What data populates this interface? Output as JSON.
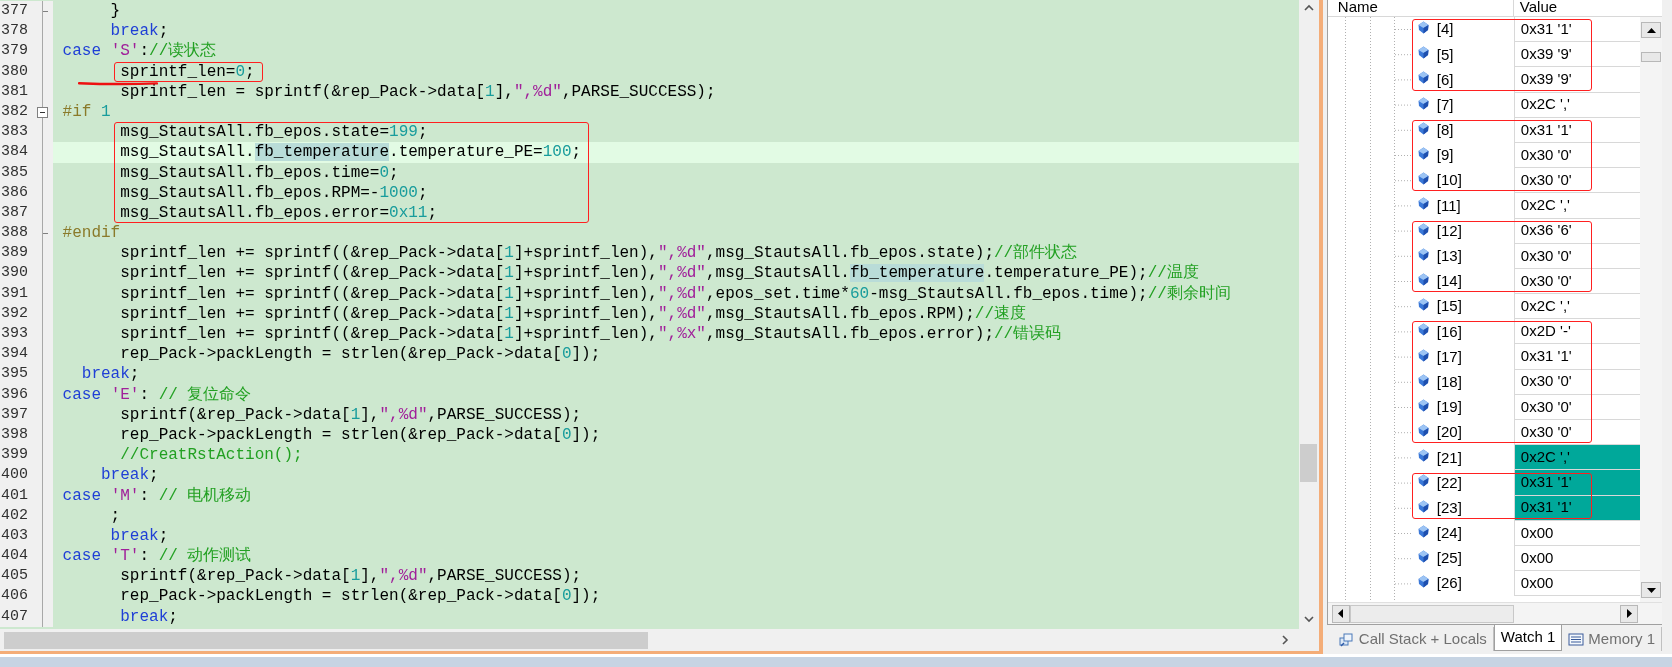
{
  "editor": {
    "lines": [
      {
        "number": "377",
        "fold_start": false,
        "fold_end": true,
        "current": false,
        "boxed": false,
        "underlined": false,
        "spans": [
          {
            "kind": "plain",
            "text": "      }"
          }
        ]
      },
      {
        "number": "378",
        "fold_start": false,
        "fold_end": false,
        "current": false,
        "boxed": false,
        "underlined": false,
        "spans": [
          {
            "kind": "keyword",
            "text": "      break"
          },
          {
            "kind": "plain",
            "text": ";"
          }
        ]
      },
      {
        "number": "379",
        "fold_start": false,
        "fold_end": false,
        "current": false,
        "boxed": false,
        "underlined": false,
        "spans": [
          {
            "kind": "keyword",
            "text": " case"
          },
          {
            "kind": "string",
            "text": " 'S'"
          },
          {
            "kind": "plain",
            "text": ":"
          },
          {
            "kind": "comment",
            "text": "//读状态"
          }
        ]
      },
      {
        "number": "380",
        "fold_start": false,
        "fold_end": false,
        "current": false,
        "boxed": true,
        "underlined": true,
        "spans": [
          {
            "kind": "plain",
            "text": "       sprintf_len="
          },
          {
            "kind": "number",
            "text": "0"
          },
          {
            "kind": "plain",
            "text": ";"
          }
        ]
      },
      {
        "number": "381",
        "fold_start": false,
        "fold_end": false,
        "current": false,
        "boxed": false,
        "underlined": false,
        "spans": [
          {
            "kind": "plain",
            "text": "       sprintf_len = sprintf(&rep_Pack->data["
          },
          {
            "kind": "number",
            "text": "1"
          },
          {
            "kind": "plain",
            "text": "],"
          },
          {
            "kind": "string",
            "text": "\",%d\""
          },
          {
            "kind": "plain",
            "text": ",PARSE_SUCCESS);"
          }
        ]
      },
      {
        "number": "382",
        "fold_start": true,
        "fold_end": false,
        "current": false,
        "boxed": false,
        "underlined": false,
        "spans": [
          {
            "kind": "preprocessor",
            "text": " #if"
          },
          {
            "kind": "number",
            "text": " 1"
          }
        ]
      },
      {
        "number": "383",
        "fold_start": false,
        "fold_end": false,
        "current": false,
        "boxed": true,
        "underlined": false,
        "spans": [
          {
            "kind": "plain",
            "text": "       msg_StautsAll.fb_epos.state="
          },
          {
            "kind": "number",
            "text": "199"
          },
          {
            "kind": "plain",
            "text": ";"
          }
        ]
      },
      {
        "number": "384",
        "fold_start": false,
        "fold_end": false,
        "current": true,
        "boxed": true,
        "underlined": false,
        "spans": [
          {
            "kind": "plain",
            "text": "       msg_StautsAll."
          },
          {
            "kind": "match",
            "text": "fb_temperature"
          },
          {
            "kind": "plain",
            "text": ".temperature_PE="
          },
          {
            "kind": "number",
            "text": "100"
          },
          {
            "kind": "plain",
            "text": ";"
          }
        ]
      },
      {
        "number": "385",
        "fold_start": false,
        "fold_end": false,
        "current": false,
        "boxed": true,
        "underlined": false,
        "spans": [
          {
            "kind": "plain",
            "text": "       msg_StautsAll.fb_epos.time="
          },
          {
            "kind": "number",
            "text": "0"
          },
          {
            "kind": "plain",
            "text": ";"
          }
        ]
      },
      {
        "number": "386",
        "fold_start": false,
        "fold_end": false,
        "current": false,
        "boxed": true,
        "underlined": false,
        "spans": [
          {
            "kind": "plain",
            "text": "       msg_StautsAll.fb_epos.RPM=-"
          },
          {
            "kind": "number",
            "text": "1000"
          },
          {
            "kind": "plain",
            "text": ";"
          }
        ]
      },
      {
        "number": "387",
        "fold_start": false,
        "fold_end": false,
        "current": false,
        "boxed": true,
        "underlined": false,
        "spans": [
          {
            "kind": "plain",
            "text": "       msg_StautsAll.fb_epos.error="
          },
          {
            "kind": "number",
            "text": "0x11"
          },
          {
            "kind": "plain",
            "text": ";"
          }
        ]
      },
      {
        "number": "388",
        "fold_start": false,
        "fold_end": true,
        "current": false,
        "boxed": false,
        "underlined": false,
        "spans": [
          {
            "kind": "preprocessor",
            "text": " #endif"
          }
        ]
      },
      {
        "number": "389",
        "fold_start": false,
        "fold_end": false,
        "current": false,
        "boxed": false,
        "underlined": false,
        "spans": [
          {
            "kind": "plain",
            "text": "       sprintf_len += sprintf((&rep_Pack->data["
          },
          {
            "kind": "number",
            "text": "1"
          },
          {
            "kind": "plain",
            "text": "]+sprintf_len),"
          },
          {
            "kind": "string",
            "text": "\",%d\""
          },
          {
            "kind": "plain",
            "text": ",msg_StautsAll.fb_epos.state);"
          },
          {
            "kind": "comment",
            "text": "//部件状态"
          }
        ]
      },
      {
        "number": "390",
        "fold_start": false,
        "fold_end": false,
        "current": false,
        "boxed": false,
        "underlined": false,
        "spans": [
          {
            "kind": "plain",
            "text": "       sprintf_len += sprintf((&rep_Pack->data["
          },
          {
            "kind": "number",
            "text": "1"
          },
          {
            "kind": "plain",
            "text": "]+sprintf_len),"
          },
          {
            "kind": "string",
            "text": "\",%d\""
          },
          {
            "kind": "plain",
            "text": ",msg_StautsAll."
          },
          {
            "kind": "match",
            "text": "fb_temperature"
          },
          {
            "kind": "plain",
            "text": ".temperature_PE);"
          },
          {
            "kind": "comment",
            "text": "//温度"
          }
        ]
      },
      {
        "number": "391",
        "fold_start": false,
        "fold_end": false,
        "current": false,
        "boxed": false,
        "underlined": false,
        "spans": [
          {
            "kind": "plain",
            "text": "       sprintf_len += sprintf((&rep_Pack->data["
          },
          {
            "kind": "number",
            "text": "1"
          },
          {
            "kind": "plain",
            "text": "]+sprintf_len),"
          },
          {
            "kind": "string",
            "text": "\",%d\""
          },
          {
            "kind": "plain",
            "text": ",epos_set.time*"
          },
          {
            "kind": "number",
            "text": "60"
          },
          {
            "kind": "plain",
            "text": "-msg_StautsAll.fb_epos.time);"
          },
          {
            "kind": "comment",
            "text": "//剩余时间"
          }
        ]
      },
      {
        "number": "392",
        "fold_start": false,
        "fold_end": false,
        "current": false,
        "boxed": false,
        "underlined": false,
        "spans": [
          {
            "kind": "plain",
            "text": "       sprintf_len += sprintf((&rep_Pack->data["
          },
          {
            "kind": "number",
            "text": "1"
          },
          {
            "kind": "plain",
            "text": "]+sprintf_len),"
          },
          {
            "kind": "string",
            "text": "\",%d\""
          },
          {
            "kind": "plain",
            "text": ",msg_StautsAll.fb_epos.RPM);"
          },
          {
            "kind": "comment",
            "text": "//速度"
          }
        ]
      },
      {
        "number": "393",
        "fold_start": false,
        "fold_end": false,
        "current": false,
        "boxed": false,
        "underlined": false,
        "spans": [
          {
            "kind": "plain",
            "text": "       sprintf_len += sprintf((&rep_Pack->data["
          },
          {
            "kind": "number",
            "text": "1"
          },
          {
            "kind": "plain",
            "text": "]+sprintf_len),"
          },
          {
            "kind": "string",
            "text": "\",%x\""
          },
          {
            "kind": "plain",
            "text": ",msg_StautsAll.fb_epos.error);"
          },
          {
            "kind": "comment",
            "text": "//错误码"
          }
        ]
      },
      {
        "number": "394",
        "fold_start": false,
        "fold_end": false,
        "current": false,
        "boxed": false,
        "underlined": false,
        "spans": [
          {
            "kind": "plain",
            "text": "       rep_Pack->packLength = strlen(&rep_Pack->data["
          },
          {
            "kind": "number",
            "text": "0"
          },
          {
            "kind": "plain",
            "text": "]);"
          }
        ]
      },
      {
        "number": "395",
        "fold_start": false,
        "fold_end": false,
        "current": false,
        "boxed": false,
        "underlined": false,
        "spans": [
          {
            "kind": "keyword",
            "text": "   break"
          },
          {
            "kind": "plain",
            "text": ";"
          }
        ]
      },
      {
        "number": "396",
        "fold_start": false,
        "fold_end": false,
        "current": false,
        "boxed": false,
        "underlined": false,
        "spans": [
          {
            "kind": "keyword",
            "text": " case"
          },
          {
            "kind": "string",
            "text": " 'E'"
          },
          {
            "kind": "plain",
            "text": ":"
          },
          {
            "kind": "comment",
            "text": " // 复位命令"
          }
        ]
      },
      {
        "number": "397",
        "fold_start": false,
        "fold_end": false,
        "current": false,
        "boxed": false,
        "underlined": false,
        "spans": [
          {
            "kind": "plain",
            "text": "       sprintf(&rep_Pack->data["
          },
          {
            "kind": "number",
            "text": "1"
          },
          {
            "kind": "plain",
            "text": "],"
          },
          {
            "kind": "string",
            "text": "\",%d\""
          },
          {
            "kind": "plain",
            "text": ",PARSE_SUCCESS);"
          }
        ]
      },
      {
        "number": "398",
        "fold_start": false,
        "fold_end": false,
        "current": false,
        "boxed": false,
        "underlined": false,
        "spans": [
          {
            "kind": "plain",
            "text": "       rep_Pack->packLength = strlen(&rep_Pack->data["
          },
          {
            "kind": "number",
            "text": "0"
          },
          {
            "kind": "plain",
            "text": "]);"
          }
        ]
      },
      {
        "number": "399",
        "fold_start": false,
        "fold_end": false,
        "current": false,
        "boxed": false,
        "underlined": false,
        "spans": [
          {
            "kind": "comment",
            "text": "       //CreatRstAction();"
          }
        ]
      },
      {
        "number": "400",
        "fold_start": false,
        "fold_end": false,
        "current": false,
        "boxed": false,
        "underlined": false,
        "spans": [
          {
            "kind": "keyword",
            "text": "     break"
          },
          {
            "kind": "plain",
            "text": ";"
          }
        ]
      },
      {
        "number": "401",
        "fold_start": false,
        "fold_end": false,
        "current": false,
        "boxed": false,
        "underlined": false,
        "spans": [
          {
            "kind": "keyword",
            "text": " case"
          },
          {
            "kind": "string",
            "text": " 'M'"
          },
          {
            "kind": "plain",
            "text": ":"
          },
          {
            "kind": "comment",
            "text": " // 电机移动"
          }
        ]
      },
      {
        "number": "402",
        "fold_start": false,
        "fold_end": false,
        "current": false,
        "boxed": false,
        "underlined": false,
        "spans": [
          {
            "kind": "plain",
            "text": "      ;"
          }
        ]
      },
      {
        "number": "403",
        "fold_start": false,
        "fold_end": false,
        "current": false,
        "boxed": false,
        "underlined": false,
        "spans": [
          {
            "kind": "keyword",
            "text": "      break"
          },
          {
            "kind": "plain",
            "text": ";"
          }
        ]
      },
      {
        "number": "404",
        "fold_start": false,
        "fold_end": false,
        "current": false,
        "boxed": false,
        "underlined": false,
        "spans": [
          {
            "kind": "keyword",
            "text": " case"
          },
          {
            "kind": "string",
            "text": " 'T'"
          },
          {
            "kind": "plain",
            "text": ":"
          },
          {
            "kind": "comment",
            "text": " // 动作测试"
          }
        ]
      },
      {
        "number": "405",
        "fold_start": false,
        "fold_end": false,
        "current": false,
        "boxed": false,
        "underlined": false,
        "spans": [
          {
            "kind": "plain",
            "text": "       sprintf(&rep_Pack->data["
          },
          {
            "kind": "number",
            "text": "1"
          },
          {
            "kind": "plain",
            "text": "],"
          },
          {
            "kind": "string",
            "text": "\",%d\""
          },
          {
            "kind": "plain",
            "text": ",PARSE_SUCCESS);"
          }
        ]
      },
      {
        "number": "406",
        "fold_start": false,
        "fold_end": false,
        "current": false,
        "boxed": false,
        "underlined": false,
        "spans": [
          {
            "kind": "plain",
            "text": "       rep_Pack->packLength = strlen(&rep_Pack->data["
          },
          {
            "kind": "number",
            "text": "0"
          },
          {
            "kind": "plain",
            "text": "]);"
          }
        ]
      },
      {
        "number": "407",
        "fold_start": false,
        "fold_end": false,
        "current": false,
        "boxed": false,
        "underlined": false,
        "spans": [
          {
            "kind": "keyword",
            "text": "       break"
          },
          {
            "kind": "plain",
            "text": ";"
          }
        ]
      }
    ]
  },
  "watch": {
    "columns": [
      "Name",
      "Value"
    ],
    "rows": [
      {
        "name": "[4]",
        "value": "0x31 '1'",
        "changed": false,
        "boxed": true
      },
      {
        "name": "[5]",
        "value": "0x39 '9'",
        "changed": false,
        "boxed": true
      },
      {
        "name": "[6]",
        "value": "0x39 '9'",
        "changed": false,
        "boxed": true
      },
      {
        "name": "[7]",
        "value": "0x2C ','",
        "changed": false,
        "boxed": false
      },
      {
        "name": "[8]",
        "value": "0x31 '1'",
        "changed": false,
        "boxed": true
      },
      {
        "name": "[9]",
        "value": "0x30 '0'",
        "changed": false,
        "boxed": true
      },
      {
        "name": "[10]",
        "value": "0x30 '0'",
        "changed": false,
        "boxed": true
      },
      {
        "name": "[11]",
        "value": "0x2C ','",
        "changed": false,
        "boxed": false
      },
      {
        "name": "[12]",
        "value": "0x36 '6'",
        "changed": false,
        "boxed": true
      },
      {
        "name": "[13]",
        "value": "0x30 '0'",
        "changed": false,
        "boxed": true
      },
      {
        "name": "[14]",
        "value": "0x30 '0'",
        "changed": false,
        "boxed": true
      },
      {
        "name": "[15]",
        "value": "0x2C ','",
        "changed": false,
        "boxed": false
      },
      {
        "name": "[16]",
        "value": "0x2D '-'",
        "changed": false,
        "boxed": true
      },
      {
        "name": "[17]",
        "value": "0x31 '1'",
        "changed": false,
        "boxed": true
      },
      {
        "name": "[18]",
        "value": "0x30 '0'",
        "changed": false,
        "boxed": true
      },
      {
        "name": "[19]",
        "value": "0x30 '0'",
        "changed": false,
        "boxed": true
      },
      {
        "name": "[20]",
        "value": "0x30 '0'",
        "changed": false,
        "boxed": true
      },
      {
        "name": "[21]",
        "value": "0x2C ','",
        "changed": true,
        "boxed": false
      },
      {
        "name": "[22]",
        "value": "0x31 '1'",
        "changed": true,
        "boxed": true
      },
      {
        "name": "[23]",
        "value": "0x31 '1'",
        "changed": true,
        "boxed": true
      },
      {
        "name": "[24]",
        "value": "0x00",
        "changed": false,
        "boxed": false
      },
      {
        "name": "[25]",
        "value": "0x00",
        "changed": false,
        "boxed": false
      },
      {
        "name": "[26]",
        "value": "0x00",
        "changed": false,
        "boxed": false
      }
    ],
    "tabs": [
      {
        "kind": "stack",
        "label": "Call Stack + Locals",
        "selected": false
      },
      {
        "kind": "watch",
        "label": "Watch 1",
        "selected": true
      },
      {
        "kind": "memory",
        "label": "Memory 1",
        "selected": false
      }
    ]
  }
}
